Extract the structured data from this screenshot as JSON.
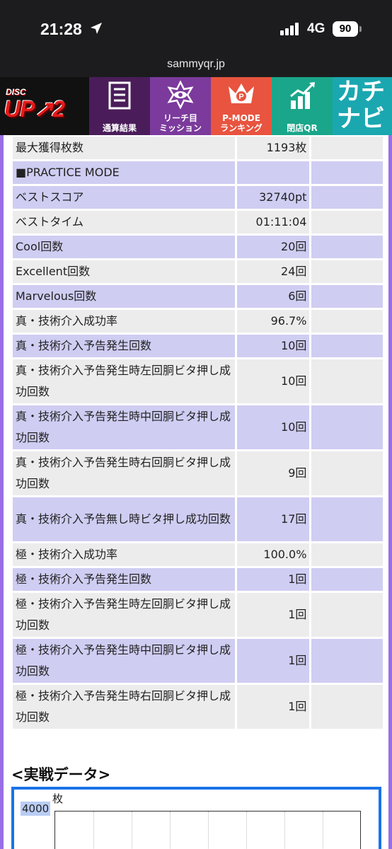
{
  "status_bar": {
    "time": "21:28",
    "network": "4G",
    "battery": "90"
  },
  "browser": {
    "url": "sammyqr.jp"
  },
  "nav": {
    "logo_small": "DISC",
    "logo_main": "UP↗2",
    "items": [
      {
        "label": "通算結果",
        "icon": "list-icon"
      },
      {
        "label": "リーチ目\nミッション",
        "icon": "eye-icon"
      },
      {
        "label": "P-MODE\nランキング",
        "icon": "crown-icon"
      },
      {
        "label": "閉店QR",
        "icon": "chart-up-icon"
      }
    ],
    "kachi_top": "カチ",
    "kachi_bottom": "ナビ"
  },
  "stats": {
    "rows": [
      {
        "label": "最大獲得枚数",
        "value": "1193枚",
        "extra": ""
      },
      {
        "label": "■PRACTICE MODE",
        "value": "",
        "extra": "",
        "header": true
      },
      {
        "label": "ベストスコア",
        "value": "32740pt",
        "extra": ""
      },
      {
        "label": "ベストタイム",
        "value": "01:11:04",
        "extra": ""
      },
      {
        "label": "Cool回数",
        "value": "20回",
        "extra": ""
      },
      {
        "label": "Excellent回数",
        "value": "24回",
        "extra": ""
      },
      {
        "label": "Marvelous回数",
        "value": "6回",
        "extra": ""
      },
      {
        "label": "真・技術介入成功率",
        "value": "96.7%",
        "extra": ""
      },
      {
        "label": "真・技術介入予告発生回数",
        "value": "10回",
        "extra": ""
      },
      {
        "label": "真・技術介入予告発生時左回胴ビタ押し成功回数",
        "value": "10回",
        "extra": ""
      },
      {
        "label": "真・技術介入予告発生時中回胴ビタ押し成功回数",
        "value": "10回",
        "extra": ""
      },
      {
        "label": "真・技術介入予告発生時右回胴ビタ押し成功回数",
        "value": "9回",
        "extra": ""
      },
      {
        "label": "真・技術介入予告無し時ビタ押し成功回数",
        "value": "17回",
        "extra": ""
      },
      {
        "label": "極・技術介入成功率",
        "value": "100.0%",
        "extra": ""
      },
      {
        "label": "極・技術介入予告発生回数",
        "value": "1回",
        "extra": ""
      },
      {
        "label": "極・技術介入予告発生時左回胴ビタ押し成功回数",
        "value": "1回",
        "extra": ""
      },
      {
        "label": "極・技術介入予告発生時中回胴ビタ押し成功回数",
        "value": "1回",
        "extra": ""
      },
      {
        "label": "極・技術介入予告発生時右回胴ビタ押し成功回数",
        "value": "1回",
        "extra": ""
      }
    ]
  },
  "section": {
    "title": "<実戦データ>"
  },
  "chart": {
    "y_max_label": "4000",
    "y_unit": "枚"
  }
}
